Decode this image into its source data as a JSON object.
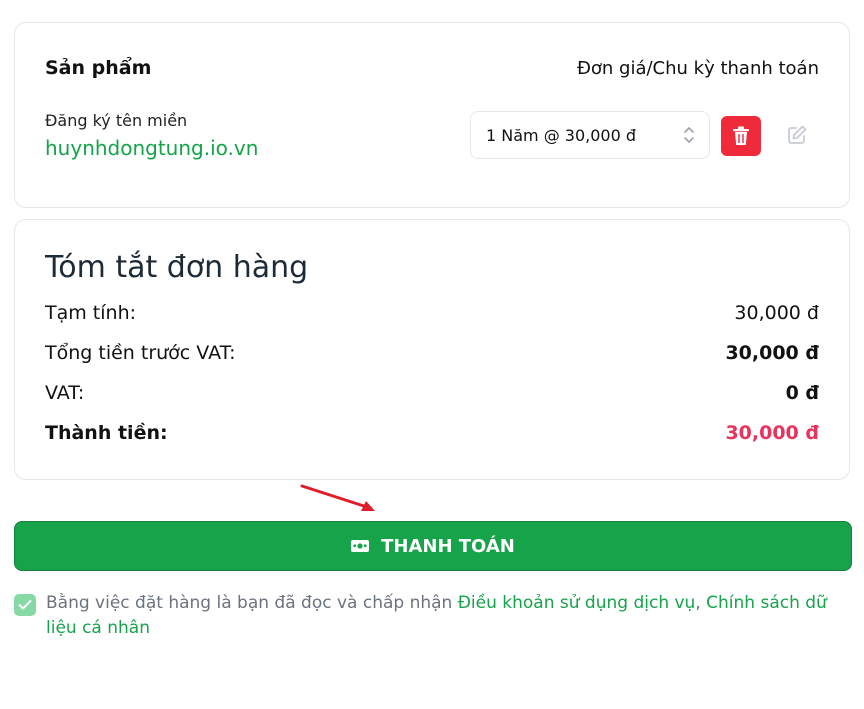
{
  "products": {
    "header_title": "Sản phẩm",
    "header_price": "Đơn giá/Chu kỳ thanh toán",
    "item": {
      "type": "Đăng ký tên miền",
      "domain": "huynhdongtung.io.vn",
      "cycle_selected": "1 Năm @ 30,000 đ"
    },
    "icons": {
      "delete": "trash-icon",
      "edit": "edit-icon",
      "select": "chevron-updown-icon"
    }
  },
  "summary": {
    "title": "Tóm tắt đơn hàng",
    "rows": [
      {
        "label": "Tạm tính:",
        "value": "30,000 đ"
      },
      {
        "label": "Tổng tiền trước VAT:",
        "value": "30,000 đ"
      },
      {
        "label": "VAT:",
        "value": "0 đ"
      },
      {
        "label": "Thành tiền:",
        "value": "30,000 đ"
      }
    ]
  },
  "checkout": {
    "button_label": "THANH TOÁN",
    "icon": "payment-icon"
  },
  "terms": {
    "prefix": "Bằng việc đặt hàng là bạn đã đọc và chấp nhận ",
    "link1": "Điều khoản sử dụng dịch vụ",
    "sep": ", ",
    "link2": "Chính sách dữ liệu cá nhân",
    "checked": true
  },
  "colors": {
    "brand_green": "#16a34a",
    "danger_red": "#ef2b3b",
    "total_pink": "#e8345c"
  }
}
